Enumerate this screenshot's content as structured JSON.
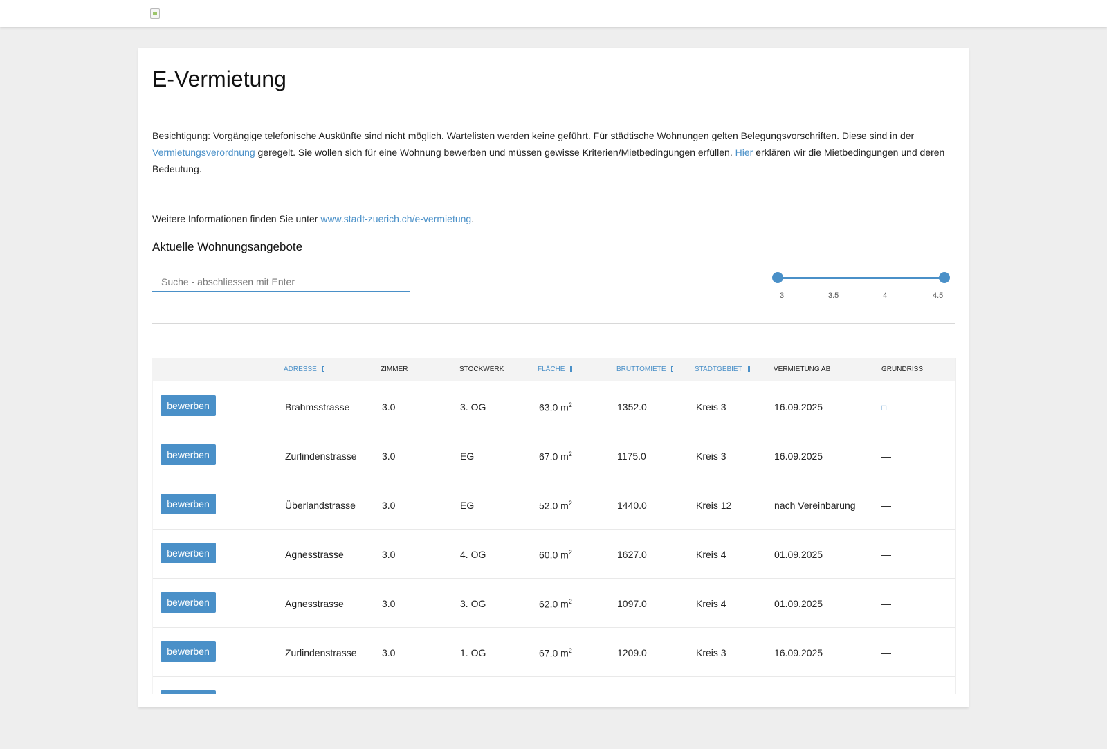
{
  "page": {
    "title": "E-Vermietung",
    "intro_1": "Besichtigung: Vorgängige telefonische Auskünfte sind nicht möglich. Wartelisten werden keine geführt. Für städtische Wohnungen gelten Belegungsvorschriften. Diese sind in der ",
    "intro_link_1": "Vermietungsverordnung",
    "intro_2": " geregelt. Sie wollen sich für eine Wohnung bewerben und müssen gewisse Kriterien/Mietbedingungen erfüllen. ",
    "intro_link_2": "Hier",
    "intro_3": " erklären wir die Mietbedingungen und deren Bedeutung.",
    "info_text": "Weitere Informationen finden Sie unter ",
    "info_link": "www.stadt-zuerich.ch/e-vermietung",
    "info_end": ".",
    "subtitle": "Aktuelle Wohnungsangebote"
  },
  "search": {
    "placeholder": "Suche - abschliessen mit Enter",
    "value": ""
  },
  "room_filter": {
    "min": 3,
    "max": 4.5,
    "selected_min": 3,
    "selected_max": 4.5,
    "labels": [
      "3",
      "3.5",
      "4",
      "4.5"
    ]
  },
  "table": {
    "headers": [
      "",
      "Adresse",
      "Zimmer",
      "Stockwerk",
      "Fläche",
      "Bruttomiete",
      "Stadtgebiet",
      "Vermietung ab",
      "Grundriss"
    ],
    "button_label": "bewerben",
    "area_unit": "m",
    "area_exp": "2",
    "rows": [
      {
        "address": "Brahmsstrasse",
        "rooms": "3.0",
        "floor": "3. OG",
        "area": "63.0",
        "rent": "1352.0",
        "district": "Kreis 3",
        "available": "16.09.2025",
        "floorplan": "icon"
      },
      {
        "address": "Zurlindenstrasse",
        "rooms": "3.0",
        "floor": "EG",
        "area": "67.0",
        "rent": "1175.0",
        "district": "Kreis 3",
        "available": "16.09.2025",
        "floorplan": "—"
      },
      {
        "address": "Überlandstrasse",
        "rooms": "3.0",
        "floor": "EG",
        "area": "52.0",
        "rent": "1440.0",
        "district": "Kreis 12",
        "available": "nach Vereinbarung",
        "floorplan": "—"
      },
      {
        "address": "Agnesstrasse",
        "rooms": "3.0",
        "floor": "4. OG",
        "area": "60.0",
        "rent": "1627.0",
        "district": "Kreis 4",
        "available": "01.09.2025",
        "floorplan": "—"
      },
      {
        "address": "Agnesstrasse",
        "rooms": "3.0",
        "floor": "3. OG",
        "area": "62.0",
        "rent": "1097.0",
        "district": "Kreis 4",
        "available": "01.09.2025",
        "floorplan": "—"
      },
      {
        "address": "Zurlindenstrasse",
        "rooms": "3.0",
        "floor": "1. OG",
        "area": "67.0",
        "rent": "1209.0",
        "district": "Kreis 3",
        "available": "16.09.2025",
        "floorplan": "—"
      }
    ]
  },
  "colors": {
    "accent": "#4a90c8",
    "background": "#eeeeee",
    "card": "#ffffff"
  }
}
